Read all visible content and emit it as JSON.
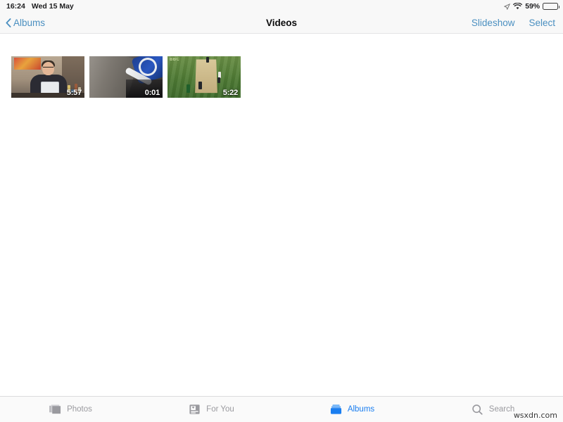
{
  "status_bar": {
    "time": "16:24",
    "date": "Wed 15 May",
    "location_icon": "location-arrow-icon",
    "wifi_icon": "wifi-icon",
    "battery_percent": "59%",
    "battery_level": 59,
    "battery_icon": "battery-icon"
  },
  "nav_bar": {
    "back_label": "Albums",
    "back_icon": "chevron-left-icon",
    "title": "Videos",
    "slideshow_label": "Slideshow",
    "select_label": "Select",
    "tint_color": "#4a8fc0"
  },
  "grid": {
    "items": [
      {
        "name": "video-person-tablet",
        "duration": "5:57",
        "badge": ""
      },
      {
        "name": "video-asphalt-closeup",
        "duration": "0:01",
        "badge": ""
      },
      {
        "name": "video-cricket-match",
        "duration": "5:22",
        "badge": "BBC"
      }
    ]
  },
  "tab_bar": {
    "active_color": "#1a7ef0",
    "inactive_color": "#9a9a9f",
    "tabs": [
      {
        "label": "Photos",
        "icon": "photos-stack-icon",
        "active": false
      },
      {
        "label": "For You",
        "icon": "for-you-card-icon",
        "active": false
      },
      {
        "label": "Albums",
        "icon": "albums-box-icon",
        "active": true
      },
      {
        "label": "Search",
        "icon": "search-magnifier-icon",
        "active": false
      }
    ]
  },
  "watermark": {
    "text": "wsxdn.com"
  }
}
